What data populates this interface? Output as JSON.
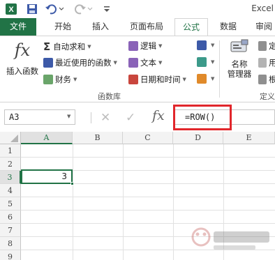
{
  "window": {
    "title": "Excel"
  },
  "tabs": [
    "文件",
    "开始",
    "插入",
    "页面布局",
    "公式",
    "数据",
    "审阅"
  ],
  "active_tab": "公式",
  "ribbon": {
    "insert_function": {
      "icon": "fx",
      "label": "插入函数"
    },
    "function_library": {
      "autosum": "自动求和",
      "recently_used": "最近使用的函数",
      "financial": "财务",
      "logical": "逻辑",
      "text": "文本",
      "date_time": "日期和时间",
      "group_label": "函数库"
    },
    "defined_names": {
      "name_manager_line1": "名称",
      "name_manager_line2": "管理器",
      "define_name_partial": "定",
      "use_in_formula_partial": "用",
      "create_partial": "根",
      "group_label_partial": "定义"
    }
  },
  "formula_bar": {
    "name_box": "A3",
    "formula": "=ROW()",
    "fx": "fx"
  },
  "grid": {
    "columns": [
      "A",
      "B",
      "C",
      "D",
      "E"
    ],
    "rows": [
      "1",
      "2",
      "3",
      "4",
      "5",
      "6",
      "7",
      "8",
      "9"
    ],
    "active_cell": "A3",
    "active_value": "3"
  },
  "colors": {
    "accent": "#217346",
    "highlight_box": "#e1262b"
  }
}
